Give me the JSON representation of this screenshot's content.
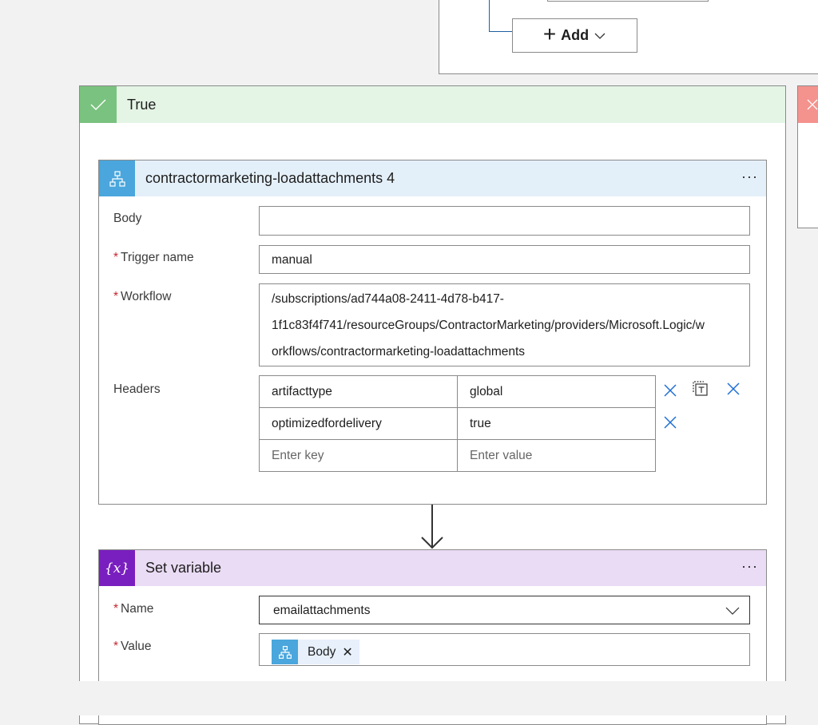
{
  "top_card": {
    "add_label": "Add"
  },
  "true_scope": {
    "title": "True"
  },
  "http_action": {
    "title": "contractormarketing-loadattachments 4",
    "more": "···",
    "body": {
      "label": "Body",
      "value": ""
    },
    "trigger": {
      "label": "Trigger name",
      "value": "manual"
    },
    "workflow": {
      "label": "Workflow",
      "lines": [
        "/subscriptions/ad744a08-2411-4d78-b417-",
        "1f1c83f4f741/resourceGroups/ContractorMarketing/providers/Microsoft.Logic/w",
        "orkflows/contractormarketing-loadattachments"
      ]
    },
    "headers": {
      "label": "Headers",
      "rows": [
        {
          "key": "artifacttype",
          "value": "global"
        },
        {
          "key": "optimizedfordelivery",
          "value": "true"
        }
      ],
      "placeholder_key": "Enter key",
      "placeholder_value": "Enter value"
    }
  },
  "set_variable": {
    "title": "Set variable",
    "icon_text": "{x}",
    "more": "···",
    "name": {
      "label": "Name",
      "value": "emailattachments"
    },
    "value": {
      "label": "Value",
      "token": "Body"
    }
  },
  "colors": {
    "true_header": "#e4f4e5",
    "true_icon": "#7ac27f",
    "false_icon": "#f4928d",
    "http_header": "#e4f0f9",
    "http_icon": "#4aa6dc",
    "variable_header": "#eadcf5",
    "variable_icon": "#7a1fbf",
    "link_blue": "#1f6fd4"
  }
}
